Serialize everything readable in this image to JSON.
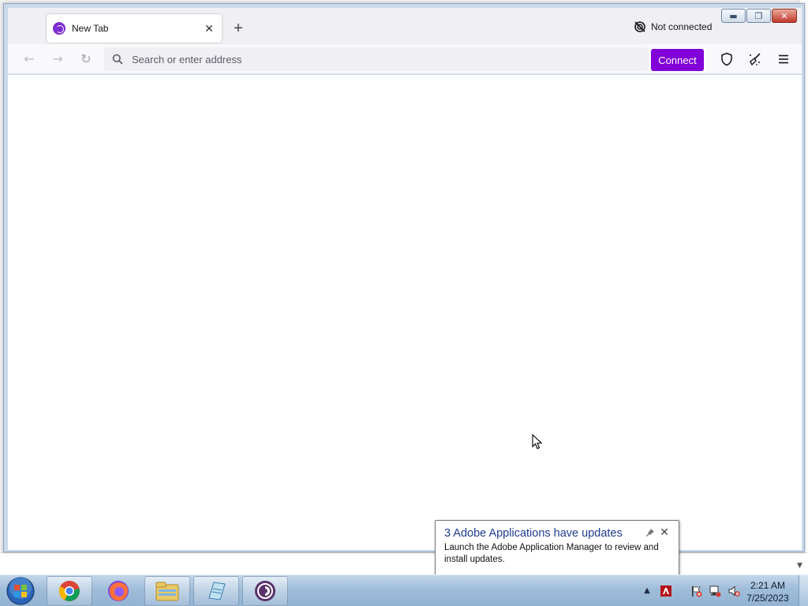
{
  "browser": {
    "tab": {
      "title": "New Tab",
      "favicon": "tor-browser-icon"
    },
    "new_tab_label": "+",
    "connection_status": "Not connected",
    "window_buttons": {
      "minimize": "minimize",
      "maximize": "maximize",
      "close": "close"
    },
    "toolbar": {
      "back_icon": "back-arrow-icon",
      "forward_icon": "forward-arrow-icon",
      "reload_icon": "reload-icon",
      "address_placeholder": "Search or enter address",
      "connect_label": "Connect",
      "accent_color": "#8000d7"
    }
  },
  "notification": {
    "title": "3 Adobe Applications have updates",
    "body": "Launch the Adobe Application Manager to review and install updates."
  },
  "taskbar": {
    "apps": [
      "chrome-icon",
      "firefox-icon",
      "file-explorer-icon",
      "notepad-icon",
      "tor-browser-icon"
    ],
    "clock_time": "2:21 AM",
    "clock_date": "7/25/2023"
  }
}
